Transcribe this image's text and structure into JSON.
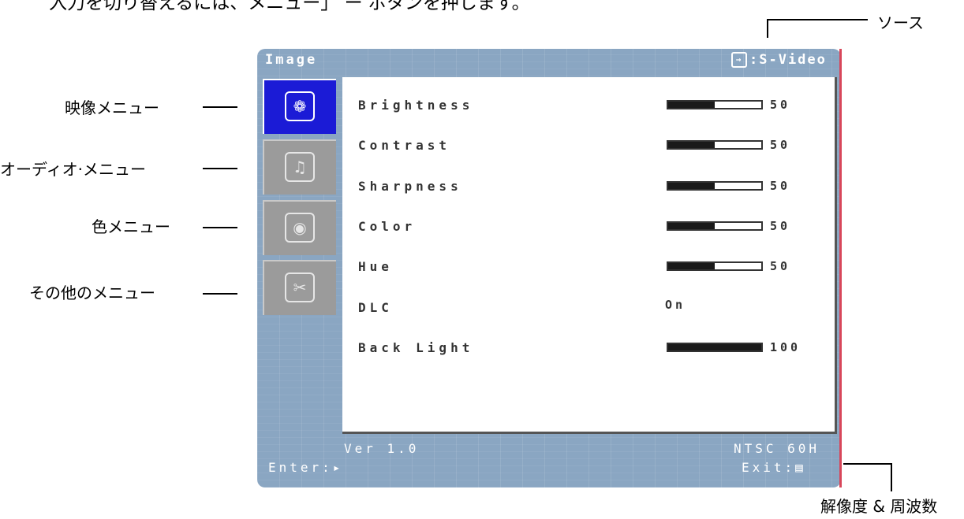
{
  "caption": "入力を切り替えるには、メニュー」 ー ボタンを押します。",
  "callouts": {
    "source": "ソース",
    "image_menu": "映像メニュー",
    "audio_menu": "オーディオ·メニュー",
    "color_menu": "色メニュー",
    "other_menu": "その他のメニュー",
    "resolution": "解像度 & 周波数"
  },
  "osd": {
    "title": "Image",
    "source_icon": "input-source-icon",
    "source_value": ":S-Video",
    "menu_icons": [
      {
        "name": "image-menu-icon",
        "glyph": "❁",
        "active": true
      },
      {
        "name": "audio-menu-icon",
        "glyph": "♫",
        "active": false
      },
      {
        "name": "color-menu-icon",
        "glyph": "◉",
        "active": false
      },
      {
        "name": "other-menu-icon",
        "glyph": "✂",
        "active": false
      }
    ],
    "settings": [
      {
        "label": "Brightness",
        "type": "bar",
        "level": 0.5,
        "value": "50"
      },
      {
        "label": "Contrast",
        "type": "bar",
        "level": 0.5,
        "value": "50"
      },
      {
        "label": "Sharpness",
        "type": "bar",
        "level": 0.5,
        "value": "50"
      },
      {
        "label": "Color",
        "type": "bar",
        "level": 0.5,
        "value": "50"
      },
      {
        "label": "Hue",
        "type": "bar",
        "level": 0.5,
        "value": "50"
      },
      {
        "label": "DLC",
        "type": "text",
        "value": "On"
      },
      {
        "label": "Back Light",
        "type": "bar",
        "level": 1.0,
        "value": "100"
      }
    ],
    "version": "Ver 1.0",
    "signal": "NTSC 60H",
    "enter": "Enter:▸",
    "exit": "Exit:▤"
  }
}
